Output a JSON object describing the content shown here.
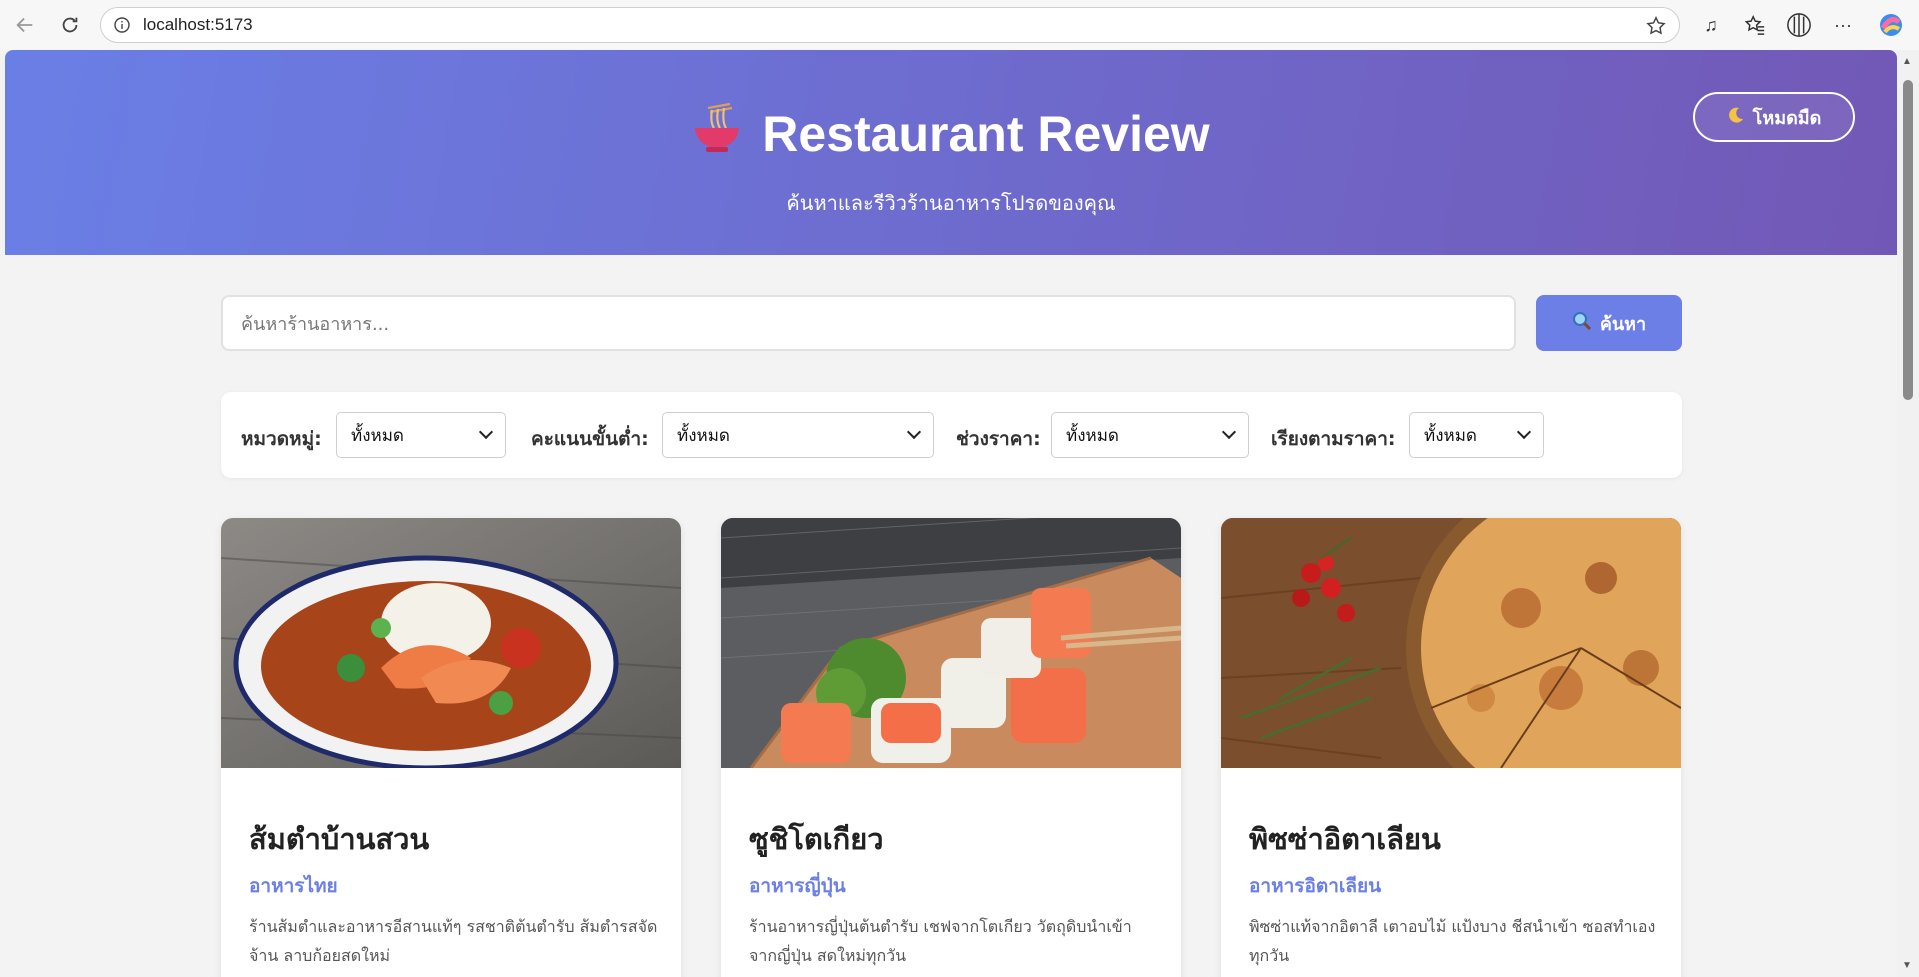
{
  "browser": {
    "url": "localhost:5173"
  },
  "header": {
    "title": "Restaurant Review",
    "subtitle": "ค้นหาและรีวิวร้านอาหารโปรดของคุณ",
    "dark_mode_label": "โหมดมืด",
    "logo_icon": "noodle-bowl-icon"
  },
  "search": {
    "placeholder": "ค้นหาร้านอาหาร...",
    "button_label": "ค้นหา"
  },
  "filters": {
    "category_label": "หมวดหมู่:",
    "category_value": "ทั้งหมด",
    "rating_label": "คะแนนขั้นต่ำ:",
    "rating_value": "ทั้งหมด",
    "price_label": "ช่วงราคา:",
    "price_value": "ทั้งหมด",
    "sort_label": "เรียงตามราคา:",
    "sort_value": "ทั้งหมด"
  },
  "restaurants": [
    {
      "name": "ส้มตำบ้านสวน",
      "category": "อาหารไทย",
      "description": "ร้านส้มตำและอาหารอีสานแท้ๆ รสชาติต้นตำรับ ส้มตำรสจัดจ้าน ลาบก้อยสดใหม่"
    },
    {
      "name": "ซูชิโตเกียว",
      "category": "อาหารญี่ปุ่น",
      "description": "ร้านอาหารญี่ปุ่นต้นตำรับ เชฟจากโตเกียว วัตถุดิบนำเข้าจากญี่ปุ่น สดใหม่ทุกวัน"
    },
    {
      "name": "พิซซ่าอิตาเลียน",
      "category": "อาหารอิตาเลียน",
      "description": "พิซซ่าแท้จากอิตาลี เตาอบไม้ แป้งบาง ชีสนำเข้า ซอสทำเองทุกวัน"
    }
  ],
  "colors": {
    "accent": "#6b7fe6",
    "hero_start": "#6a7fe6",
    "hero_end": "#7258b6"
  }
}
